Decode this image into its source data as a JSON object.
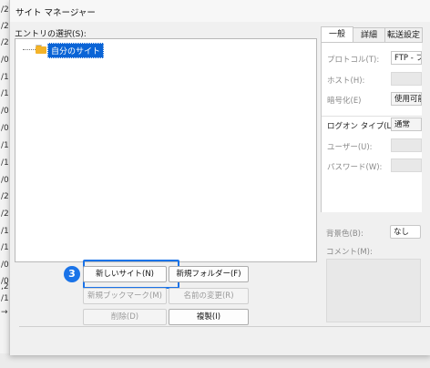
{
  "background_glyphs": [
    "/2",
    "/2",
    "/2",
    "/0",
    "/1",
    "/1",
    "/0",
    "/0",
    "/1",
    "/1",
    "/0",
    "/2",
    "/2",
    "/1",
    "/1",
    "/0",
    "/0",
    "/1",
    "/0",
    "/1",
    ",2",
    "→"
  ],
  "dialog": {
    "title": "サイト マネージャー",
    "entry_label": "エントリの選択(S):",
    "tree": {
      "selected_item": "自分のサイト"
    },
    "buttons": {
      "new_site": "新しいサイト(N)",
      "new_folder": "新規フォルダー(F)",
      "new_bookmark": "新規ブックマーク(M)",
      "rename": "名前の変更(R)",
      "delete": "削除(D)",
      "duplicate": "複製(I)"
    },
    "step_badge": "3",
    "tabs": [
      "一般",
      "詳細",
      "転送設定"
    ],
    "fields": {
      "protocol_label": "プロトコル(T):",
      "protocol_value": "FTP - ファイ",
      "host_label": "ホスト(H):",
      "encryption_label": "暗号化(E)",
      "encryption_value": "使用可能な",
      "logon_label": "ログオン タイプ(L):",
      "logon_value": "通常",
      "user_label": "ユーザー(U):",
      "password_label": "パスワード(W):",
      "bgcolor_label": "背景色(B):",
      "bgcolor_value": "なし",
      "comment_label": "コメント(M):"
    }
  },
  "colors": {
    "accent": "#1a73e8",
    "selection": "#0a64d6",
    "folder": "#f3b32a"
  }
}
